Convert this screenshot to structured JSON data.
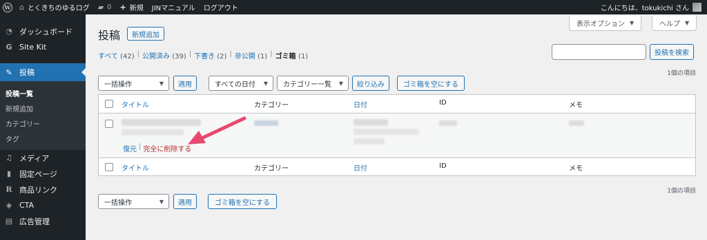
{
  "adminbar": {
    "site_name": "とくきちのゆるログ",
    "comments_count": "0",
    "new_label": "新規",
    "manual_label": "JINマニュアル",
    "logout_label": "ログアウト",
    "greeting": "こんにちは、tokukichi さん"
  },
  "sidebar": {
    "items": [
      {
        "icon": "dashboard-icon",
        "label": "ダッシュボード"
      },
      {
        "icon": "sitekit-icon",
        "label": "Site Kit"
      },
      {
        "icon": "posts-icon",
        "label": "投稿"
      },
      {
        "icon": "media-icon",
        "label": "メディア"
      },
      {
        "icon": "pages-icon",
        "label": "固定ページ"
      },
      {
        "icon": "product-link-icon",
        "label": "商品リンク"
      },
      {
        "icon": "cta-icon",
        "label": "CTA"
      },
      {
        "icon": "ad-icon",
        "label": "広告管理"
      }
    ],
    "submenu": [
      "投稿一覧",
      "新規追加",
      "カテゴリー",
      "タグ"
    ]
  },
  "header": {
    "screen_options": "表示オプション",
    "help": "ヘルプ",
    "title": "投稿",
    "add_new": "新規追加"
  },
  "filters": {
    "all": "すべて",
    "all_count": "(42)",
    "published": "公開済み",
    "published_count": "(39)",
    "draft": "下書き",
    "draft_count": "(2)",
    "private": "非公開",
    "private_count": "(1)",
    "trash": "ゴミ箱",
    "trash_count": "(1)"
  },
  "search": {
    "button": "投稿を検索",
    "value": ""
  },
  "tablenav": {
    "bulk_action": "一括操作",
    "apply": "適用",
    "all_dates": "すべての日付",
    "all_categories": "カテゴリー一覧",
    "filter": "絞り込み",
    "empty_trash": "ゴミ箱を空にする",
    "items_count": "1個の項目"
  },
  "table": {
    "columns": [
      "タイトル",
      "カテゴリー",
      "日付",
      "ID",
      "メモ"
    ],
    "row_actions": {
      "restore": "復元",
      "delete_permanently": "完全に削除する"
    }
  },
  "colors": {
    "accent": "#2271b1",
    "admin_dark": "#1d2327",
    "delete": "#b32d2e",
    "arrow": "#e8486e"
  }
}
